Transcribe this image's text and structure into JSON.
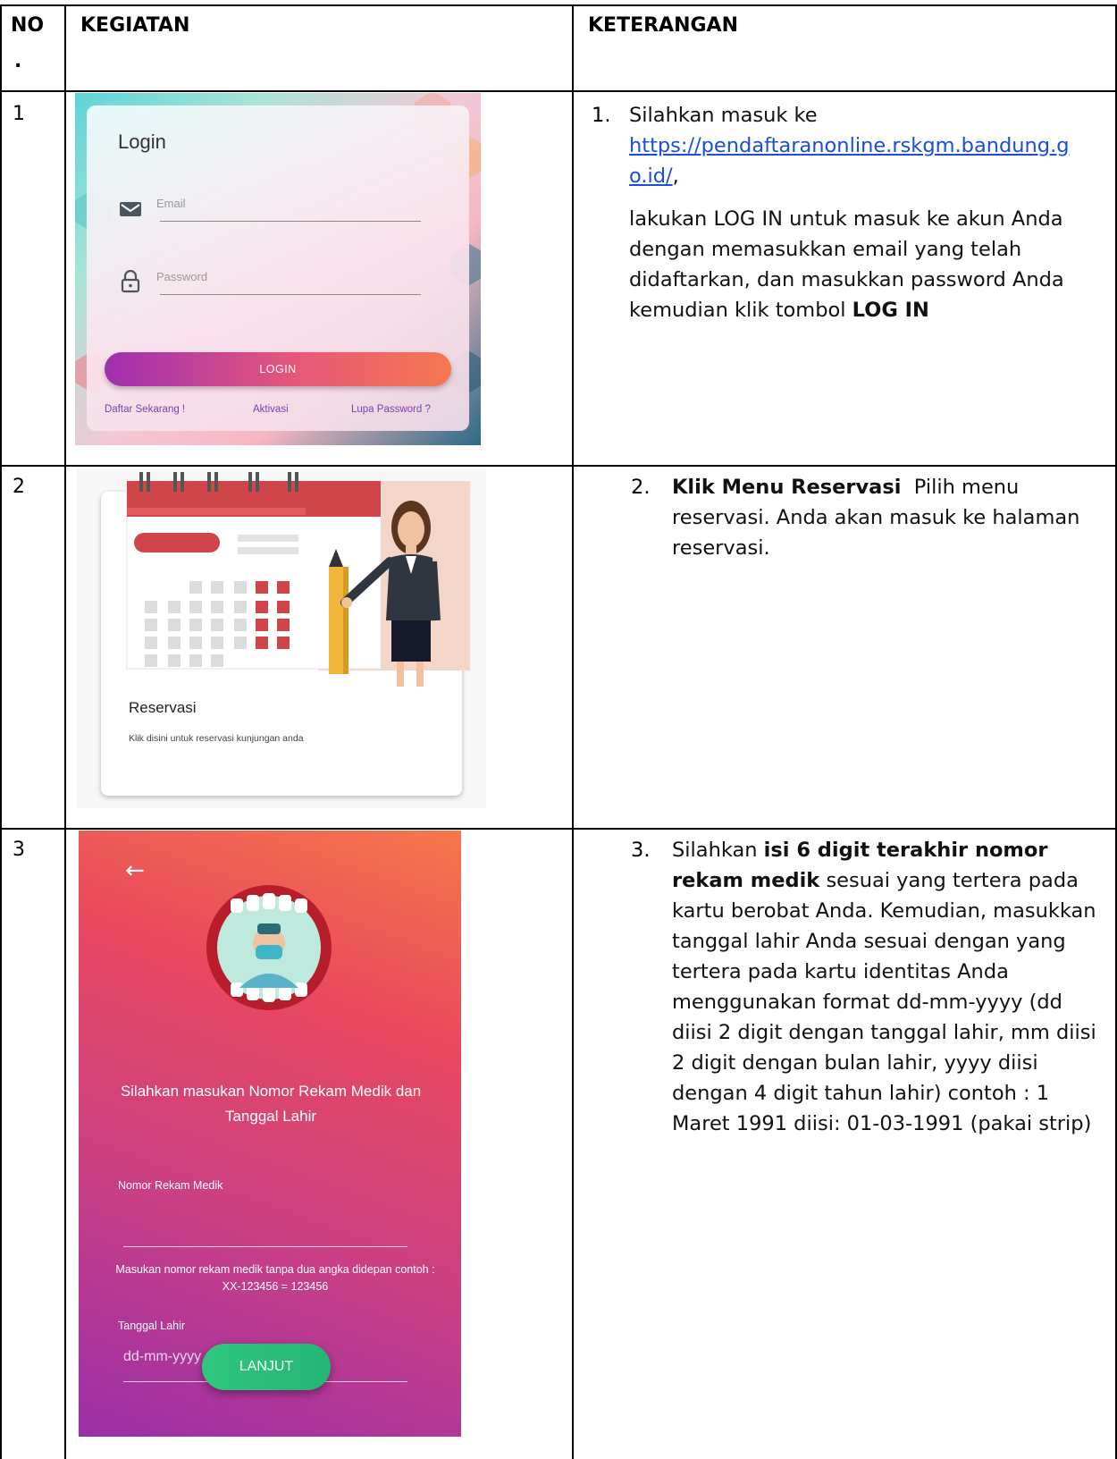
{
  "table": {
    "header": {
      "no": "NO",
      "no_dot": ".",
      "kegiatan": "KEGIATAN",
      "keterangan": "KETERANGAN"
    },
    "rows": [
      {
        "no": "1",
        "num_label": "1.",
        "note_intro": "Silahkan masuk ke",
        "note_link": "https://pendaftaranonline.rskgm.bandung.go.id/",
        "note_link_line1": "https://pendaftaranonline.rskgm.bandung.g",
        "note_link_line2": "o.id/",
        "note_comma": ",",
        "note_body": "lakukan LOG IN untuk masuk ke akun Anda dengan memasukkan email yang telah didaftarkan, dan masukkan password Anda kemudian klik tombol",
        "note_bold": "LOG IN"
      },
      {
        "no": "2",
        "num_label": "2.",
        "note_bold": "Klik Menu Reservasi",
        "note_body": "Pilih menu reservasi. Anda akan masuk ke halaman reservasi."
      },
      {
        "no": "3",
        "num_label": "3.",
        "note_pre": "Silahkan",
        "note_bold": "isi 6 digit terakhir nomor rekam medik",
        "note_body": "sesuai yang tertera pada kartu berobat Anda. Kemudian, masukkan tanggal lahir Anda sesuai dengan yang tertera pada kartu identitas Anda menggunakan format dd-mm-yyyy (dd diisi 2 digit dengan tanggal lahir, mm diisi 2 digit dengan bulan lahir, yyyy diisi dengan 4 digit tahun lahir) contoh : 1 Maret 1991 diisi: 01-03-1991 (pakai strip)"
      }
    ]
  },
  "login_screen": {
    "title": "Login",
    "email_placeholder": "Email",
    "password_placeholder": "Password",
    "login_button": "LOGIN",
    "link_register": "Daftar Sekarang !",
    "link_activate": "Aktivasi",
    "link_forgot": "Lupa Password ?",
    "icons": [
      "mail-icon",
      "lock-icon"
    ]
  },
  "reservasi_card": {
    "title": "Reservasi",
    "subtitle": "Klik disini untuk reservasi kunjungan anda"
  },
  "form_screen": {
    "title": "Silahkan masukan Nomor Rekam Medik dan Tanggal Lahir",
    "rm_label": "Nomor Rekam Medik",
    "rm_hint": "Masukan nomor rekam medik tanpa dua angka didepan contoh : XX-123456 = 123456",
    "dob_label": "Tanggal Lahir",
    "dob_placeholder": "dd-mm-yyyy",
    "button": "LANJUT",
    "icons": [
      "back-arrow-icon"
    ]
  },
  "colors": {
    "link": "#1a4fd6",
    "login_gradient": [
      "#a02fb0",
      "#f6784f"
    ],
    "form_gradient": [
      "#f7774a",
      "#9a2fa8"
    ],
    "button_green": "#2fc77e",
    "calendar_red": "#d0454a"
  }
}
